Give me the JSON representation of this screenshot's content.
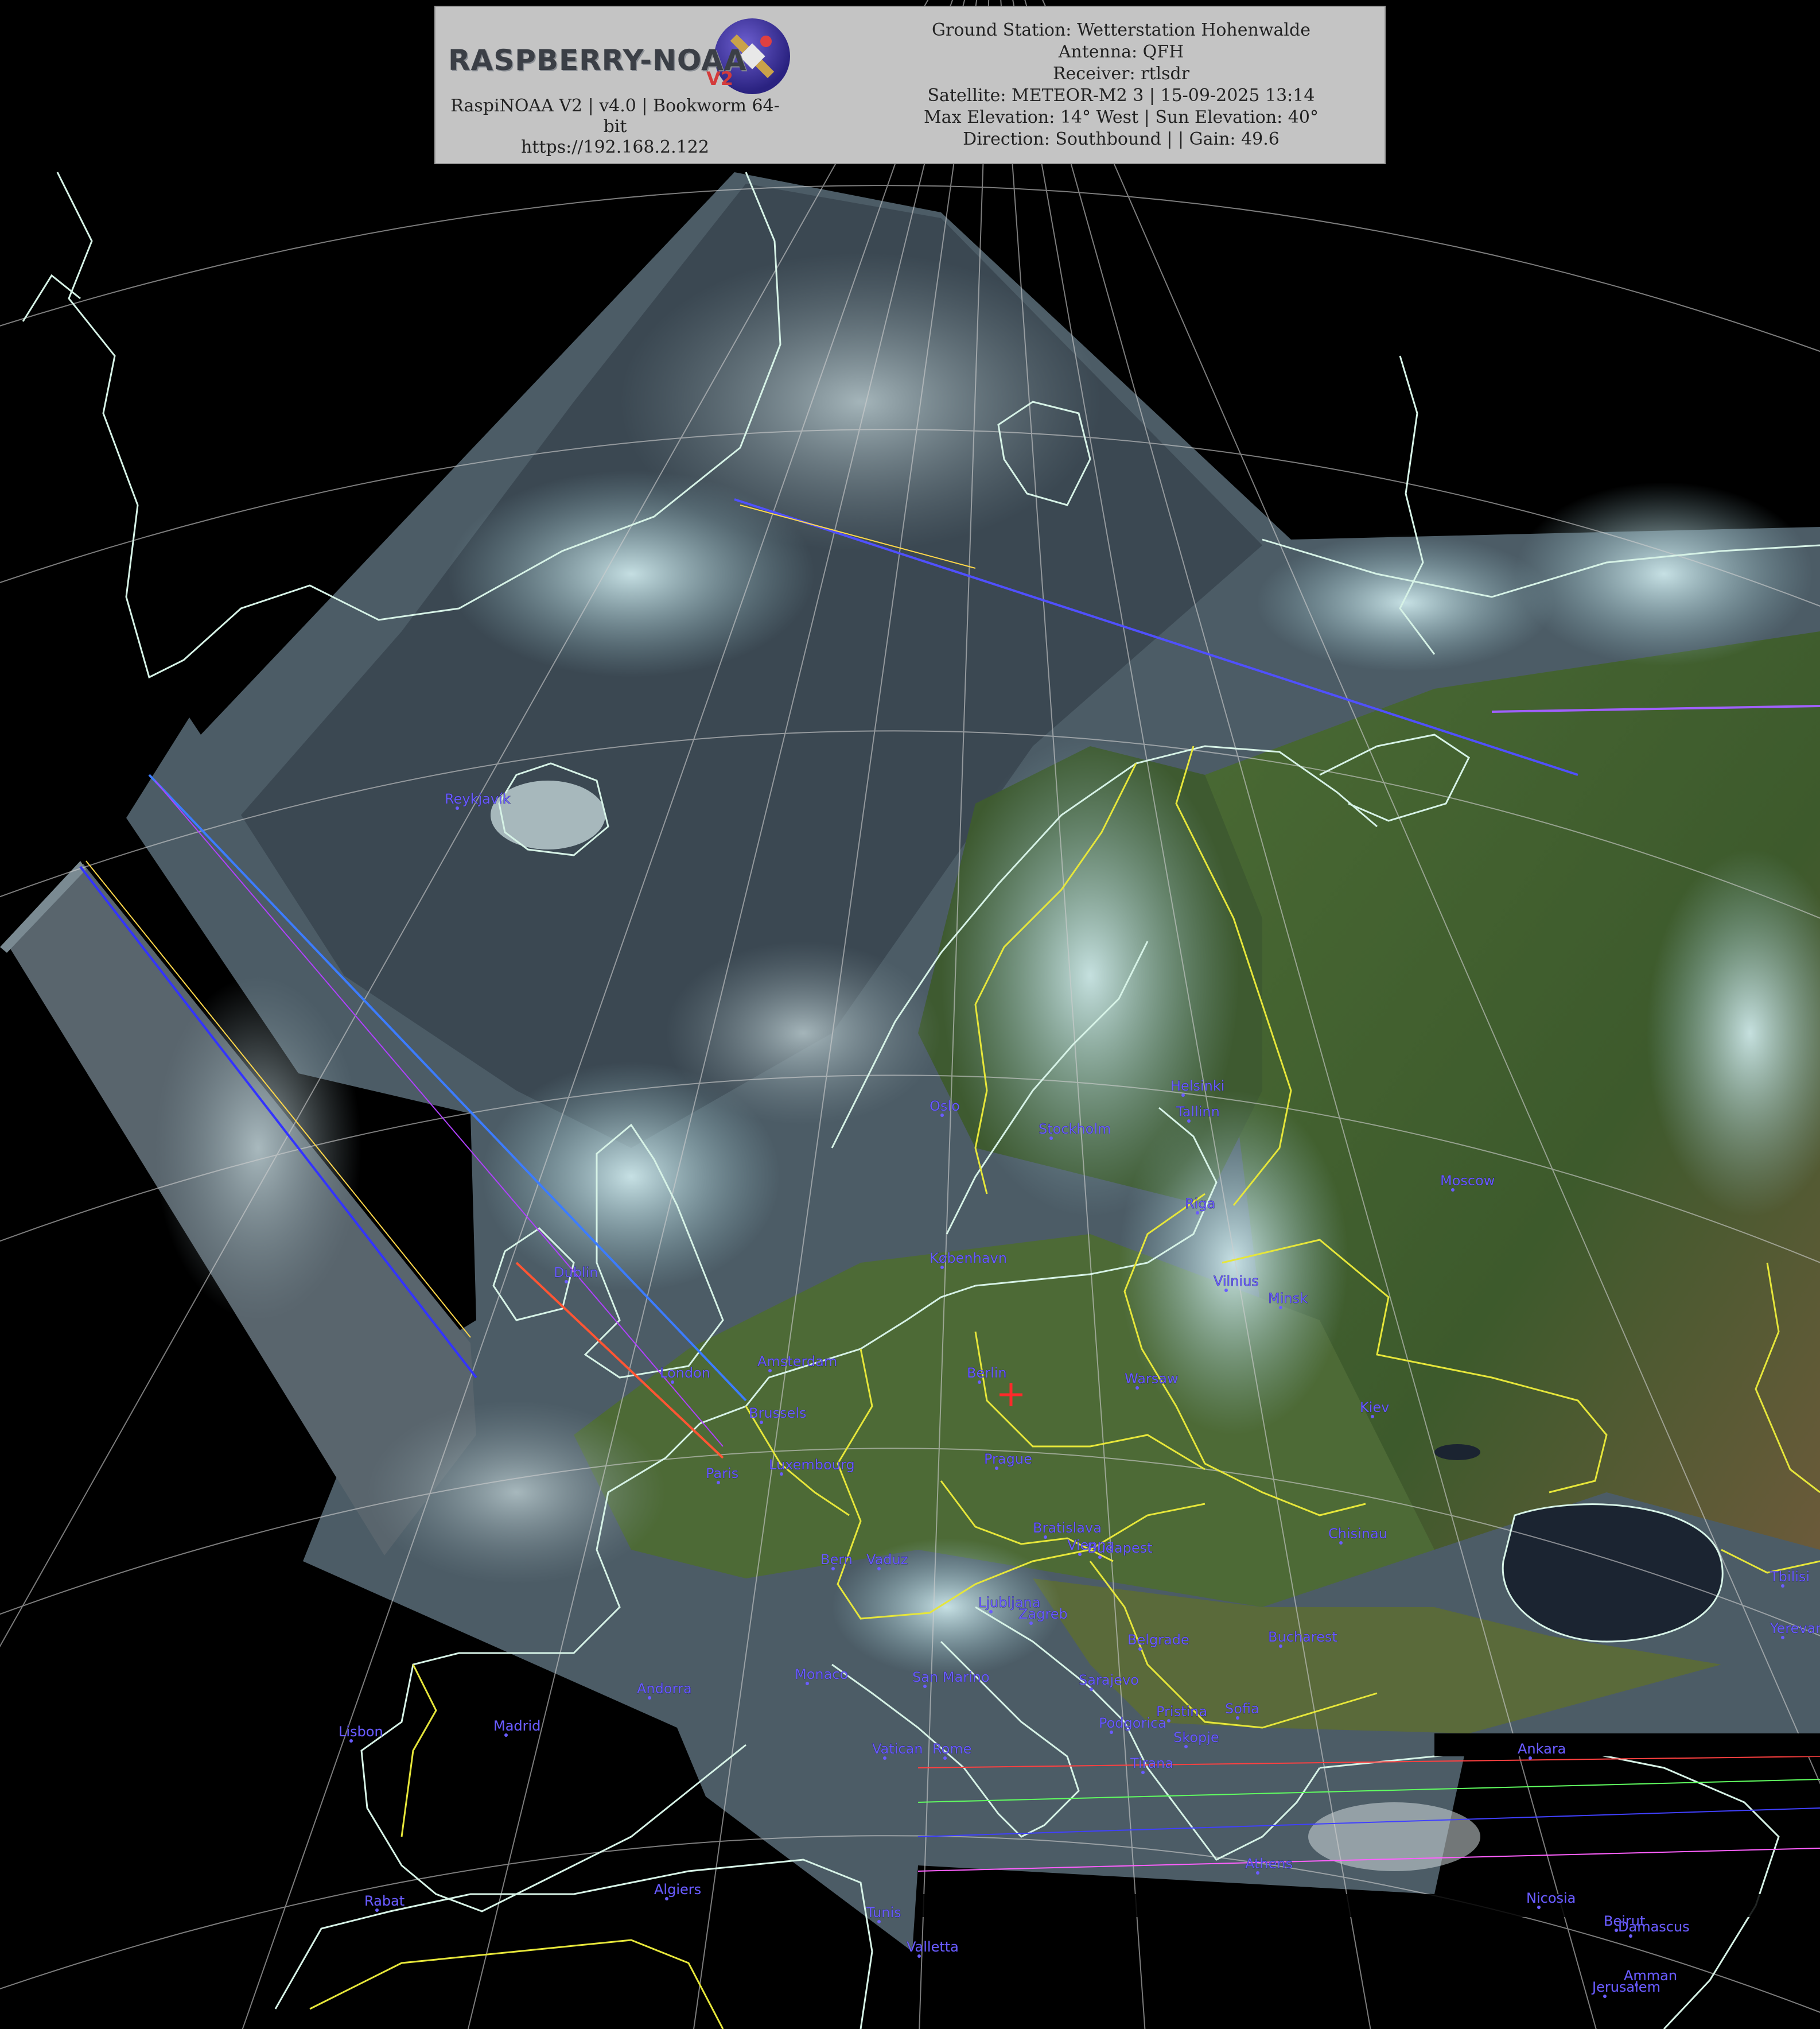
{
  "header": {
    "logo_text": "RASPBERRY-NOAA",
    "logo_version": "V2",
    "software_line": "RaspiNOAA V2 | v4.0 | Bookworm 64-bit",
    "url": "https://192.168.2.122",
    "ground_station": "Ground Station: Wetterstation Hohenwalde",
    "antenna": "Antenna: QFH",
    "receiver": "Receiver: rtlsdr",
    "satellite_line": "Satellite: METEOR-M2 3 | 15-09-2025 13:14",
    "elevation_line": "Max Elevation: 14° West | Sun Elevation: 40°",
    "direction_line": "Direction: Southbound | | Gain: 49.6"
  },
  "cities": [
    {
      "name": "Reykjavík",
      "id": "reykjavik"
    },
    {
      "name": "Oslo",
      "id": "oslo"
    },
    {
      "name": "Stockholm",
      "id": "stockholm"
    },
    {
      "name": "Helsinki",
      "id": "helsinki"
    },
    {
      "name": "Tallinn",
      "id": "tallinn"
    },
    {
      "name": "Moscow",
      "id": "moscow"
    },
    {
      "name": "Riga",
      "id": "riga"
    },
    {
      "name": "København",
      "id": "kobenhavn"
    },
    {
      "name": "Vilnius",
      "id": "vilnius"
    },
    {
      "name": "Minsk",
      "id": "minsk"
    },
    {
      "name": "Dublin",
      "id": "dublin"
    },
    {
      "name": "Amsterdam",
      "id": "amsterdam"
    },
    {
      "name": "London",
      "id": "london"
    },
    {
      "name": "Berlin",
      "id": "berlin"
    },
    {
      "name": "Warsaw",
      "id": "warsaw"
    },
    {
      "name": "Brussels",
      "id": "brussels"
    },
    {
      "name": "Kiev",
      "id": "kiev"
    },
    {
      "name": "Luxembourg",
      "id": "luxembourg"
    },
    {
      "name": "Prague",
      "id": "prague"
    },
    {
      "name": "Paris",
      "id": "paris"
    },
    {
      "name": "Vienna",
      "id": "vienna"
    },
    {
      "name": "Bratislava",
      "id": "bratislava"
    },
    {
      "name": "Budapest",
      "id": "budapest"
    },
    {
      "name": "Chisinau",
      "id": "chisinau"
    },
    {
      "name": "Bern",
      "id": "bern"
    },
    {
      "name": "Vaduz",
      "id": "vaduz"
    },
    {
      "name": "Tbilisi",
      "id": "tbilisi"
    },
    {
      "name": "Ljubljana",
      "id": "ljubljana"
    },
    {
      "name": "Zagreb",
      "id": "zagreb"
    },
    {
      "name": "Yerevan",
      "id": "yerevan"
    },
    {
      "name": "Belgrade",
      "id": "belgrade"
    },
    {
      "name": "Bucharest",
      "id": "bucharest"
    },
    {
      "name": "Monaco",
      "id": "monaco"
    },
    {
      "name": "San Marino",
      "id": "san-marino"
    },
    {
      "name": "Sarajevo",
      "id": "sarajevo"
    },
    {
      "name": "Andorra",
      "id": "andorra"
    },
    {
      "name": "Sofia",
      "id": "sofia"
    },
    {
      "name": "Pristina",
      "id": "pristina"
    },
    {
      "name": "Podgorica",
      "id": "podgorica"
    },
    {
      "name": "Skopje",
      "id": "skopje"
    },
    {
      "name": "Lisbon",
      "id": "lisbon"
    },
    {
      "name": "Madrid",
      "id": "madrid"
    },
    {
      "name": "Vatican",
      "id": "vatican"
    },
    {
      "name": "Rome",
      "id": "rome"
    },
    {
      "name": "Tirana",
      "id": "tirana"
    },
    {
      "name": "Ankara",
      "id": "ankara"
    },
    {
      "name": "Athens",
      "id": "athens"
    },
    {
      "name": "Rabat",
      "id": "rabat"
    },
    {
      "name": "Algiers",
      "id": "algiers"
    },
    {
      "name": "Tunis",
      "id": "tunis"
    },
    {
      "name": "Nicosia",
      "id": "nicosia"
    },
    {
      "name": "Beirut",
      "id": "beirut"
    },
    {
      "name": "Damascus",
      "id": "damascus"
    },
    {
      "name": "Valletta",
      "id": "valletta"
    },
    {
      "name": "Amman",
      "id": "amman"
    },
    {
      "name": "Jerusalem",
      "id": "jerusalem"
    }
  ],
  "colors": {
    "background": "#000000",
    "cloud": "#c9e7ea",
    "land": "#3d5a2c",
    "sea": "#1f2a3a",
    "border": "#e6e63a",
    "coastline": "#d6f2e6",
    "city_label": "#6a5cff",
    "station_marker": "#ff2a2a"
  }
}
